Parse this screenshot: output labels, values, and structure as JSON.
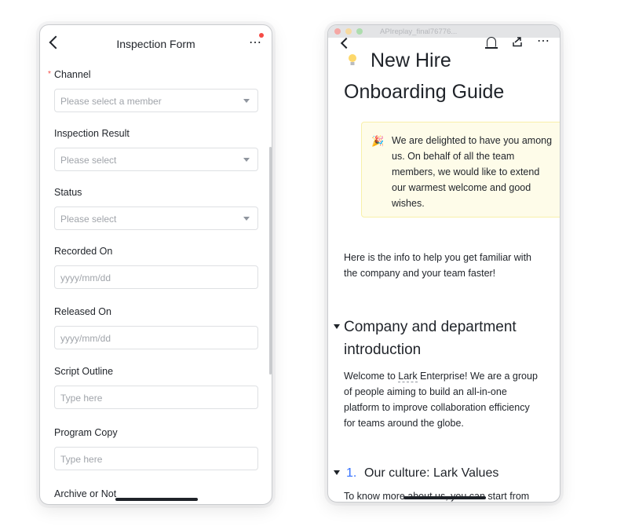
{
  "inspection_form": {
    "title": "Inspection Form",
    "more_glyph": "⋯",
    "required_mark": "*",
    "fields": [
      {
        "label": "Channel",
        "placeholder": "Please select a member",
        "type": "select"
      },
      {
        "label": "Inspection Result",
        "placeholder": "Please select",
        "type": "select"
      },
      {
        "label": "Status",
        "placeholder": "Please select",
        "type": "select"
      },
      {
        "label": "Recorded On",
        "placeholder": "yyyy/mm/dd",
        "type": "date"
      },
      {
        "label": "Released On",
        "placeholder": "yyyy/mm/dd",
        "type": "date"
      },
      {
        "label": "Script Outline",
        "placeholder": "Type here",
        "type": "text"
      },
      {
        "label": "Program Copy",
        "placeholder": "Type here",
        "type": "text"
      },
      {
        "label": "Archive or Not",
        "placeholder": "",
        "type": "partial"
      }
    ]
  },
  "doc": {
    "file_name": "APIreplay_final76776...",
    "more_glyph": "⋯",
    "title_line1": "New Hire",
    "title_line2": "Onboarding Guide",
    "callout_lines": [
      "We are delighted to have you among",
      "us. On behalf of all the team",
      "members, we would like to extend",
      "our warmest welcome and good",
      "wishes."
    ],
    "intro_lines": [
      "Here is the info to help you get familiar with",
      "the company and your team faster!"
    ],
    "section_heading_line1": "Company and department",
    "section_heading_line2": "introduction",
    "section_body_prefix": "Welcome to ",
    "section_body_link": "Lark",
    "section_body_line1_rest": " Enterprise! We are a group",
    "section_body_lines": [
      "of people aiming to build an all-in-one",
      "platform to improve collaboration efficiency",
      "for teams around the globe."
    ],
    "subsection_number": "1.",
    "subsection_heading": "Our culture: Lark Values",
    "subsection_body_partial": "To know more about us, you can start from"
  },
  "colors": {
    "required": "#f54a45",
    "accent_number": "#3370ff",
    "callout_bg": "#fefce9",
    "callout_border": "#f8f0a9"
  },
  "icons": [
    "back-icon",
    "more-icon",
    "notification-dot",
    "caret-down-icon",
    "bell-icon",
    "share-icon",
    "lightbulb-icon",
    "party-popper-icon",
    "collapse-triangle-icon"
  ]
}
